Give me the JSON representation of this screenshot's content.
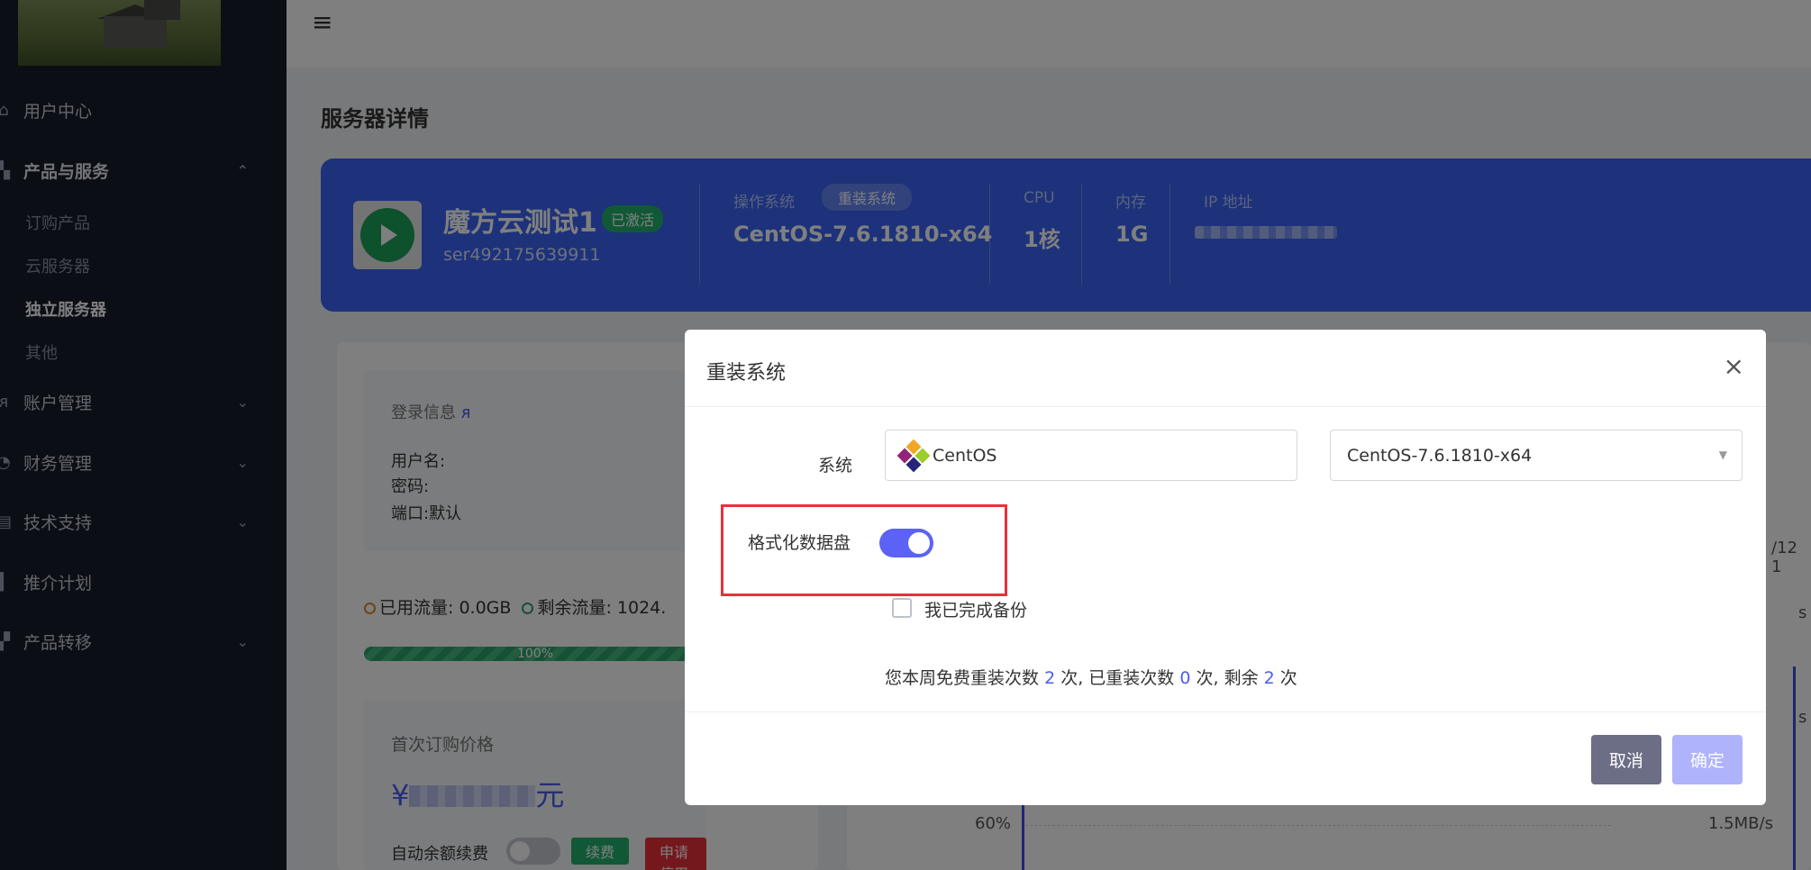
{
  "sidebar": {
    "items": [
      {
        "label": "用户中心",
        "icon": "home-icon"
      },
      {
        "label": "产品与服务",
        "icon": "grid-icon",
        "expanded": true,
        "children": [
          "订购产品",
          "云服务器",
          "独立服务器",
          "其他"
        ],
        "active_child": "独立服务器"
      },
      {
        "label": "账户管理",
        "icon": "user-icon"
      },
      {
        "label": "财务管理",
        "icon": "money-icon"
      },
      {
        "label": "技术支持",
        "icon": "support-icon"
      },
      {
        "label": "推介计划",
        "icon": "flag-icon"
      },
      {
        "label": "产品转移",
        "icon": "transfer-icon"
      }
    ]
  },
  "page": {
    "title": "服务器详情"
  },
  "server": {
    "name": "魔方云测试1",
    "status": "已激活",
    "id": "ser492175639911",
    "os_label": "操作系统",
    "reinstall_label": "重装系统",
    "os_value": "CentOS-7.6.1810-x64",
    "cpu_label": "CPU",
    "cpu_value": "1核",
    "mem_label": "内存",
    "mem_value": "1G",
    "ip_label": "IP 地址"
  },
  "details": {
    "login_title": "登录信息",
    "username_label": "用户名:",
    "password_label": "密码:",
    "port_label": "端口:",
    "port_value": "默认",
    "used_traffic": "已用流量: 0.0GB",
    "remaining_traffic": "剩余流量: 1024.",
    "progress": "100%",
    "price_title": "首次订购价格",
    "price_prefix": "¥",
    "price_suffix": "元",
    "auto_renew": "自动余额续费",
    "renew_btn": "续费",
    "stop_btn": "申请停用"
  },
  "chart_bg": {
    "date_fragment": "/12 1",
    "y_left": "60%",
    "y_right": "1.5MB/s",
    "tick_a": "s",
    "tick_b": "s"
  },
  "modal": {
    "title": "重装系统",
    "system_label": "系统",
    "os_family": "CentOS",
    "os_version": "CentOS-7.6.1810-x64",
    "format_label": "格式化数据盘",
    "backup_label": "我已完成备份",
    "quota_prefix": "您本周免费重装次数",
    "quota_free": "2",
    "quota_mid1": "次, 已重装次数",
    "quota_used": "0",
    "quota_mid2": "次, 剩余",
    "quota_left": "2",
    "quota_suffix": "次",
    "cancel": "取消",
    "confirm": "确定"
  },
  "colors": {
    "banner": "#3a65f5",
    "toggle": "#5b62f5",
    "highlight": "#e8313a"
  }
}
